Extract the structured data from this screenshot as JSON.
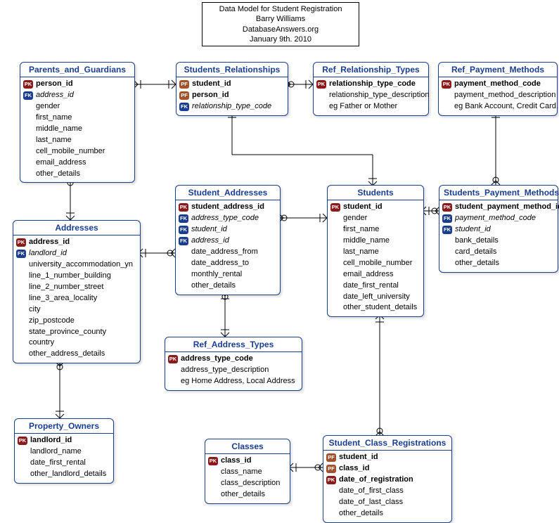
{
  "title": {
    "line1": "Data Model for Student Registration",
    "line2": "Barry Williams",
    "line3": "DatabaseAnswers.org",
    "line4": "January 9th. 2010"
  },
  "entities": {
    "parents": {
      "name": "Parents_and_Guardians",
      "attrs": [
        {
          "key": "pk",
          "name": "person_id",
          "bold": true
        },
        {
          "key": "fk",
          "name": "address_id",
          "italic": true
        },
        {
          "key": "",
          "name": "gender"
        },
        {
          "key": "",
          "name": "first_name"
        },
        {
          "key": "",
          "name": "middle_name"
        },
        {
          "key": "",
          "name": "last_name"
        },
        {
          "key": "",
          "name": "cell_mobile_number"
        },
        {
          "key": "",
          "name": "email_address"
        },
        {
          "key": "",
          "name": "other_details"
        }
      ]
    },
    "student_rel": {
      "name": "Students_Relationships",
      "attrs": [
        {
          "key": "pf",
          "name": "student_id",
          "bold": true
        },
        {
          "key": "pf",
          "name": "person_id",
          "bold": true
        },
        {
          "key": "fk",
          "name": "relationship_type_code",
          "italic": true
        }
      ]
    },
    "rel_types": {
      "name": "Ref_Relationship_Types",
      "attrs": [
        {
          "key": "pk",
          "name": "relationship_type_code",
          "bold": true
        },
        {
          "key": "",
          "name": "relationship_type_description"
        },
        {
          "key": "",
          "name": "eg Father or Mother"
        }
      ]
    },
    "payment_methods": {
      "name": "Ref_Payment_Methods",
      "attrs": [
        {
          "key": "pk",
          "name": "payment_method_code",
          "bold": true
        },
        {
          "key": "",
          "name": "payment_method_description"
        },
        {
          "key": "",
          "name": "eg Bank Account, Credit Card."
        }
      ]
    },
    "addresses": {
      "name": "Addresses",
      "attrs": [
        {
          "key": "pk",
          "name": "address_id",
          "bold": true
        },
        {
          "key": "fk",
          "name": "landlord_id",
          "italic": true
        },
        {
          "key": "",
          "name": "university_accommodation_yn"
        },
        {
          "key": "",
          "name": "line_1_number_building"
        },
        {
          "key": "",
          "name": "line_2_number_street"
        },
        {
          "key": "",
          "name": "line_3_area_locality"
        },
        {
          "key": "",
          "name": "city"
        },
        {
          "key": "",
          "name": "zip_postcode"
        },
        {
          "key": "",
          "name": "state_province_county"
        },
        {
          "key": "",
          "name": "country"
        },
        {
          "key": "",
          "name": "other_address_details"
        }
      ]
    },
    "student_addresses": {
      "name": "Student_Addresses",
      "attrs": [
        {
          "key": "pk",
          "name": "student_address_id",
          "bold": true
        },
        {
          "key": "fk",
          "name": "address_type_code",
          "italic": true
        },
        {
          "key": "fk",
          "name": "student_id",
          "italic": true
        },
        {
          "key": "fk",
          "name": "address_id",
          "italic": true
        },
        {
          "key": "",
          "name": "date_address_from"
        },
        {
          "key": "",
          "name": "date_address_to"
        },
        {
          "key": "",
          "name": "monthly_rental"
        },
        {
          "key": "",
          "name": "other_details"
        }
      ]
    },
    "students": {
      "name": "Students",
      "attrs": [
        {
          "key": "pk",
          "name": "student_id",
          "bold": true
        },
        {
          "key": "",
          "name": "gender"
        },
        {
          "key": "",
          "name": "first_name"
        },
        {
          "key": "",
          "name": "middle_name"
        },
        {
          "key": "",
          "name": "last_name"
        },
        {
          "key": "",
          "name": "cell_mobile_number"
        },
        {
          "key": "",
          "name": "email_address"
        },
        {
          "key": "",
          "name": "date_first_rental"
        },
        {
          "key": "",
          "name": "date_left_university"
        },
        {
          "key": "",
          "name": "other_student_details"
        }
      ]
    },
    "student_payment": {
      "name": "Students_Payment_Methods",
      "attrs": [
        {
          "key": "pk",
          "name": "student_payment_method_id",
          "bold": true
        },
        {
          "key": "fk",
          "name": "payment_method_code",
          "italic": true
        },
        {
          "key": "fk",
          "name": "student_id",
          "italic": true
        },
        {
          "key": "",
          "name": "bank_details"
        },
        {
          "key": "",
          "name": "card_details"
        },
        {
          "key": "",
          "name": "other_details"
        }
      ]
    },
    "ref_addr_types": {
      "name": "Ref_Address_Types",
      "attrs": [
        {
          "key": "pk",
          "name": "address_type_code",
          "bold": true
        },
        {
          "key": "",
          "name": "address_type_description"
        },
        {
          "key": "",
          "name": "eg Home Address, Local Address"
        }
      ]
    },
    "property_owners": {
      "name": "Property_Owners",
      "attrs": [
        {
          "key": "pk",
          "name": "landlord_id",
          "bold": true
        },
        {
          "key": "",
          "name": "landlord_name"
        },
        {
          "key": "",
          "name": "date_first_rental"
        },
        {
          "key": "",
          "name": "other_landlord_details"
        }
      ]
    },
    "classes": {
      "name": "Classes",
      "attrs": [
        {
          "key": "pk",
          "name": "class_id",
          "bold": true
        },
        {
          "key": "",
          "name": "class_name"
        },
        {
          "key": "",
          "name": "class_description"
        },
        {
          "key": "",
          "name": "other_details"
        }
      ]
    },
    "student_class_reg": {
      "name": "Student_Class_Registrations",
      "attrs": [
        {
          "key": "pf",
          "name": "student_id",
          "bold": true
        },
        {
          "key": "pf",
          "name": "class_id",
          "bold": true
        },
        {
          "key": "pk",
          "name": "date_of_registration",
          "bold": true
        },
        {
          "key": "",
          "name": "date_of_first_class"
        },
        {
          "key": "",
          "name": "date_of_last_class"
        },
        {
          "key": "",
          "name": "other_details"
        }
      ]
    }
  }
}
